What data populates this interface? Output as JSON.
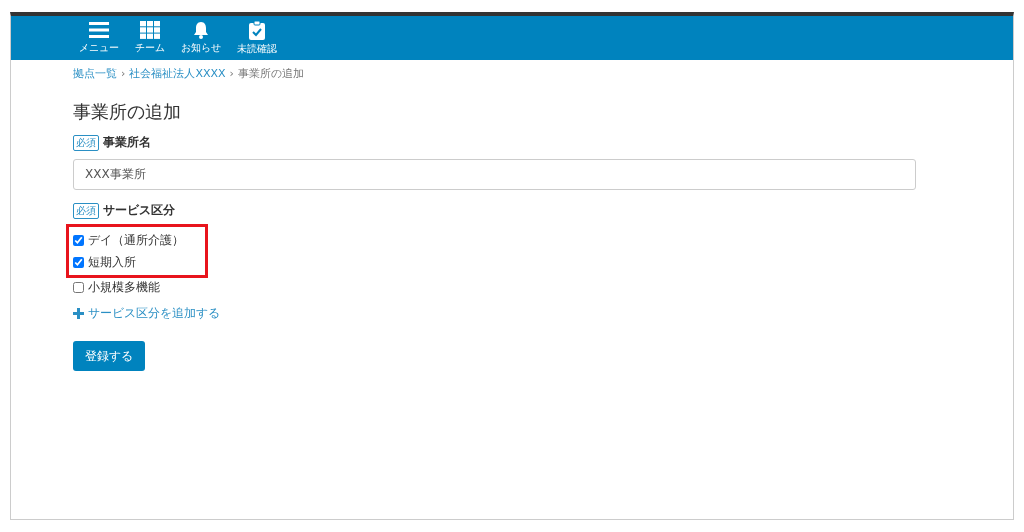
{
  "nav": [
    {
      "kind": "menu",
      "label": "メニュー"
    },
    {
      "kind": "team",
      "label": "チーム"
    },
    {
      "kind": "bell",
      "label": "お知らせ"
    },
    {
      "kind": "clipboard",
      "label": "未読確認"
    }
  ],
  "breadcrumb_separator": "›",
  "breadcrumb": [
    {
      "label": "拠点一覧",
      "link": true
    },
    {
      "label": "社会福祉法人XXXX",
      "link": true
    },
    {
      "label": "事業所の追加",
      "link": false
    }
  ],
  "title": "事業所の追加",
  "name_field": {
    "badge": "必須",
    "label": "事業所名",
    "value": "XXX事業所"
  },
  "service": {
    "badge": "必須",
    "label": "サービス区分",
    "options": [
      {
        "label": "デイ（通所介護）",
        "checked": true,
        "highlighted": true
      },
      {
        "label": "短期入所",
        "checked": true,
        "highlighted": true
      },
      {
        "label": "小規模多機能",
        "checked": false,
        "highlighted": false
      }
    ],
    "add_link": "サービス区分を追加する"
  },
  "submit": "登録する"
}
